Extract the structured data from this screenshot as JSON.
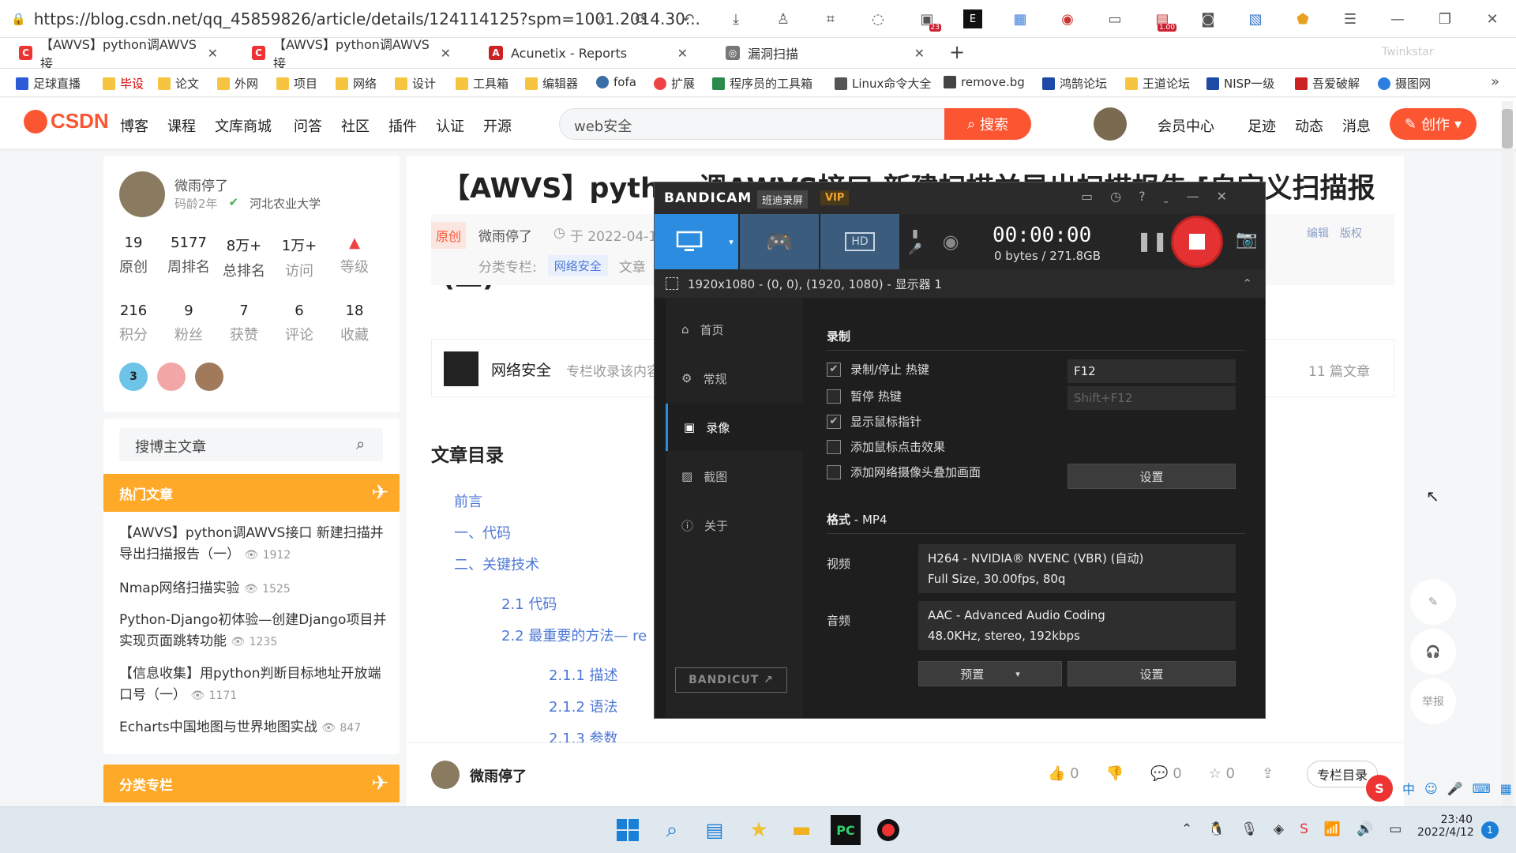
{
  "browser": {
    "url": "https://blog.csdn.net/qq_45859826/article/details/124114125?spm=1001.2014.30...",
    "toolbar_badges": {
      "b1": "23",
      "b2": "1.00"
    },
    "tabs": [
      {
        "label": "【AWVS】python调AWVS接",
        "fav": "C",
        "color": "#e33"
      },
      {
        "label": "【AWVS】python调AWVS接",
        "fav": "C",
        "color": "#e33"
      },
      {
        "label": "Acunetix - Reports",
        "fav": "A",
        "color": "#c22"
      },
      {
        "label": "漏洞扫描",
        "fav": "◎",
        "color": "#777"
      }
    ],
    "tab_extra": "Twinkstar",
    "bookmarks": [
      "足球直播",
      "毕设",
      "论文",
      "外网",
      "项目",
      "网络",
      "设计",
      "工具箱",
      "编辑器",
      "fofa",
      "扩展",
      "程序员的工具箱",
      "Linux命令大全",
      "remove.bg",
      "鸿鹄论坛",
      "王道论坛",
      "NISP一级",
      "吾爱破解",
      "摄图网"
    ]
  },
  "csdn": {
    "logo": "CSDN",
    "nav": [
      "博客",
      "课程",
      "文库商城",
      "问答",
      "社区",
      "插件",
      "认证",
      "开源"
    ],
    "search_value": "web安全",
    "search_btn": "搜索",
    "right_links": [
      "会员中心",
      "足迹",
      "动态",
      "消息"
    ],
    "create_btn": "创作"
  },
  "profile": {
    "name": "微雨停了",
    "age": "码龄2年",
    "school": "河北农业大学",
    "stats1": [
      {
        "n": "19",
        "l": "原创"
      },
      {
        "n": "5177",
        "l": "周排名"
      },
      {
        "n": "8万+",
        "l": "总排名"
      },
      {
        "n": "1万+",
        "l": "访问"
      },
      {
        "n": "",
        "l": "等级"
      }
    ],
    "stats2": [
      {
        "n": "216",
        "l": "积分"
      },
      {
        "n": "9",
        "l": "粉丝"
      },
      {
        "n": "7",
        "l": "获赞"
      },
      {
        "n": "6",
        "l": "评论"
      },
      {
        "n": "18",
        "l": "收藏"
      }
    ],
    "badge_num": "3"
  },
  "sidebar": {
    "search_placeholder": "搜博主文章",
    "hot_title": "热门文章",
    "hot": [
      {
        "title": "【AWVS】python调AWVS接口 新建扫描并导出扫描报告（一）",
        "views": "1912"
      },
      {
        "title": "Nmap网络扫描实验",
        "views": "1525"
      },
      {
        "title": "Python-Django初体验—创建Django项目并实现页面跳转功能",
        "views": "1235"
      },
      {
        "title": "【信息收集】用python判断目标地址开放端口号（一）",
        "views": "1171"
      },
      {
        "title": "Echarts中国地图与世界地图实战",
        "views": "847"
      }
    ],
    "cat_title": "分类专栏"
  },
  "article": {
    "title_line1": "【AWVS】python调AWVS接口 新建扫描并导出扫描报告 [自定义扫描报告]",
    "title_line2": "(三)",
    "tag_original": "原创",
    "author": "微雨停了",
    "date": "于 2022-04-1",
    "category_label": "分类专栏:",
    "category": "网络安全",
    "category_more": "文章",
    "edit": "编辑",
    "copyright": "版权",
    "column_name": "网络安全",
    "column_desc": "专栏收录该内容",
    "column_count": "11 篇文章",
    "toc_title": "文章目录",
    "toc": [
      {
        "t": "前言",
        "lvl": 1
      },
      {
        "t": "一、代码",
        "lvl": 1
      },
      {
        "t": "二、关键技术",
        "lvl": 1
      },
      {
        "t": "2.1 代码",
        "lvl": 2
      },
      {
        "t": "2.2 最重要的方法— re",
        "lvl": 2
      },
      {
        "t": "2.1.1 描述",
        "lvl": 3
      },
      {
        "t": "2.1.2 语法",
        "lvl": 3
      },
      {
        "t": "2.1.3 参数",
        "lvl": 3
      }
    ],
    "footer_author": "微雨停了",
    "likes": "0",
    "comments": "0",
    "favs": "0",
    "column_toc_btn": "专栏目录"
  },
  "bandicam": {
    "brand": "BANDICAM",
    "brand_sub": "班迪录屏",
    "vip": "VIP",
    "timer": "00:00:00",
    "size": "0 bytes / 271.8GB",
    "region": "1920x1080 - (0, 0), (1920, 1080) - 显示器 1",
    "nav": [
      "首页",
      "常规",
      "录像",
      "截图",
      "关于"
    ],
    "section_record": "录制",
    "options": [
      {
        "label": "录制/停止 热键",
        "checked": true
      },
      {
        "label": "暂停 热键",
        "checked": false
      },
      {
        "label": "显示鼠标指针",
        "checked": true
      },
      {
        "label": "添加鼠标点击效果",
        "checked": false
      },
      {
        "label": "添加网络摄像头叠加画面",
        "checked": false
      }
    ],
    "hotkey1": "F12",
    "hotkey2": "Shift+F12",
    "settings_btn": "设置",
    "format_label": "格式",
    "format_value": " - MP4",
    "video_label": "视频",
    "video_line1": "H264 - NVIDIA® NVENC (VBR) (自动)",
    "video_line2": "Full Size, 30.00fps, 80q",
    "audio_label": "音频",
    "audio_line1": "AAC - Advanced Audio Coding",
    "audio_line2": "48.0KHz, stereo, 192kbps",
    "preset_btn": "预置",
    "settings_btn2": "设置",
    "bandicut": "BANDICUT ↗"
  },
  "right_tools": {
    "report": "举报"
  },
  "taskbar": {
    "time": "23:40",
    "date": "2022/4/12",
    "ime": "中",
    "notif": "1"
  }
}
